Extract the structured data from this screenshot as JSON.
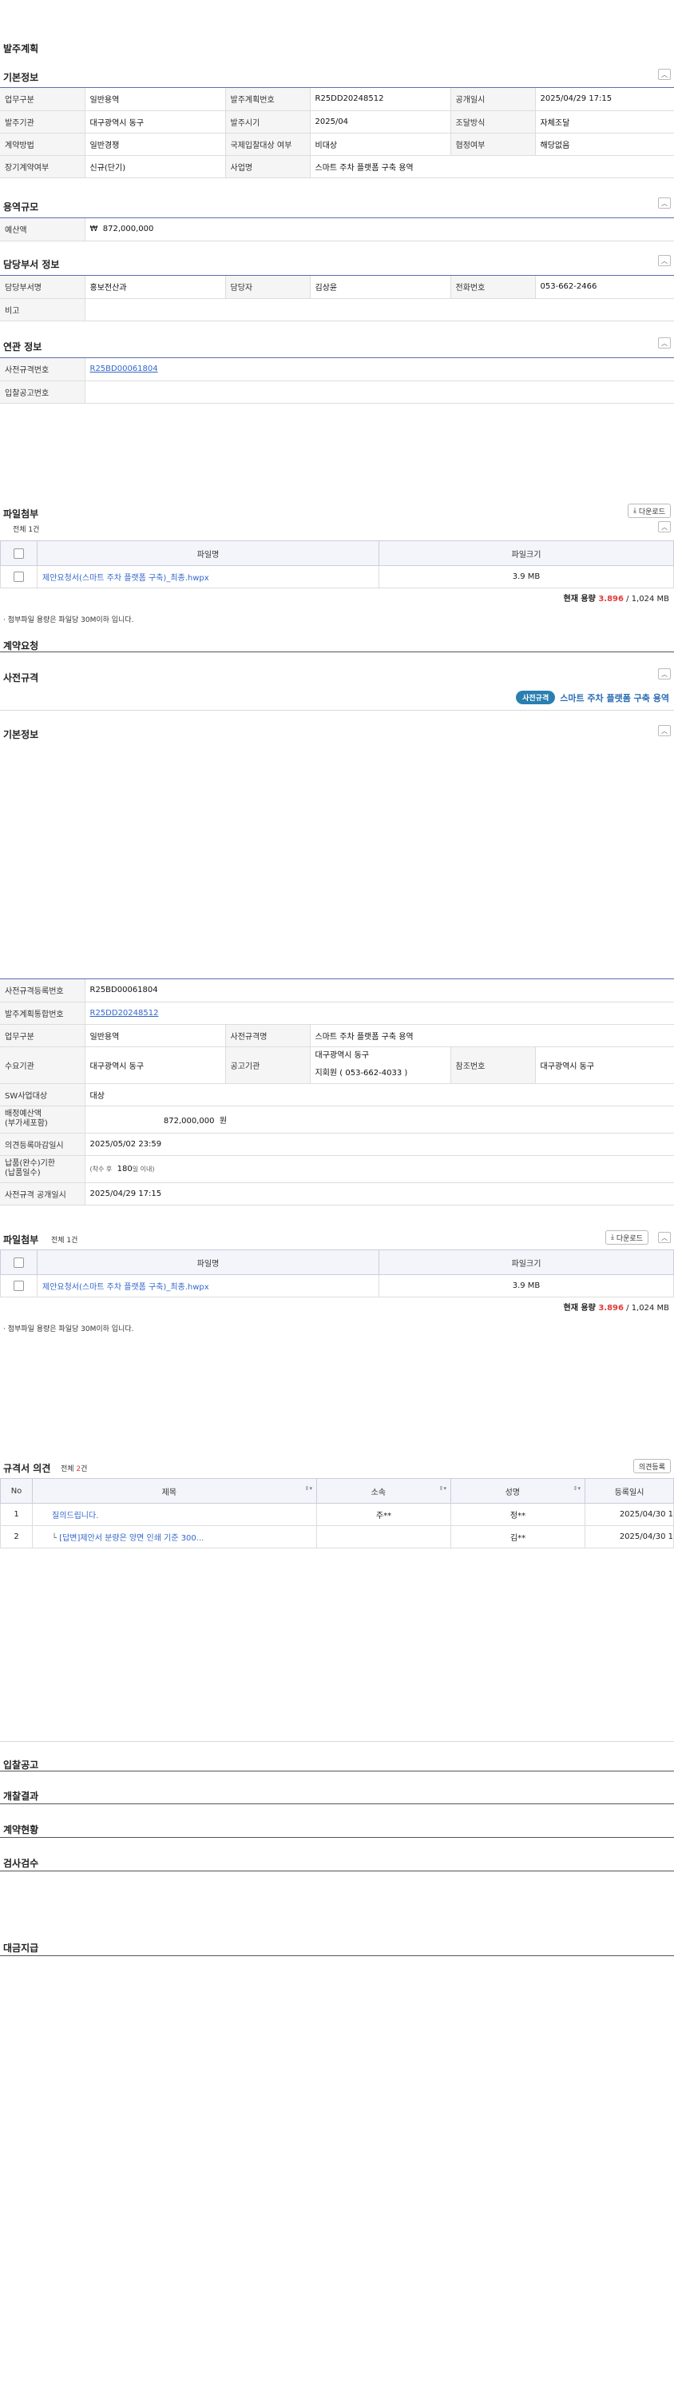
{
  "page_title": "발주계획",
  "basic": {
    "title": "기본정보",
    "rows": [
      [
        {
          "l": "업무구분",
          "v": "일반용역"
        },
        {
          "l": "발주계획번호",
          "v": "R25DD20248512"
        },
        {
          "l": "공개일시",
          "v": "2025/04/29 17:15"
        }
      ],
      [
        {
          "l": "발주기관",
          "v": "대구광역시 동구"
        },
        {
          "l": "발주시기",
          "v": "2025/04"
        },
        {
          "l": "조달방식",
          "v": "자체조달"
        }
      ],
      [
        {
          "l": "계약방법",
          "v": "일반경쟁"
        },
        {
          "l": "국제입찰대상 여부",
          "v": "비대상"
        },
        {
          "l": "협정여부",
          "v": "해당없음"
        }
      ],
      [
        {
          "l": "장기계약여부",
          "v": "신규(단기)"
        },
        {
          "l": "사업명",
          "v": "스마트 주차 플랫폼 구축 용역"
        }
      ]
    ]
  },
  "budget": {
    "title": "용역규모",
    "label": "예산액",
    "currency": "₩",
    "value": "872,000,000"
  },
  "dept": {
    "title": "담당부서 정보",
    "row1": [
      {
        "l": "담당부서명",
        "v": "홍보전산과"
      },
      {
        "l": "담당자",
        "v": "김상윤"
      },
      {
        "l": "전화번호",
        "v": "053-662-2466"
      }
    ],
    "remark_label": "비고",
    "remark": ""
  },
  "related": {
    "title": "연관 정보",
    "rows": [
      {
        "l": "사전규격번호",
        "v": "R25BD00061804"
      },
      {
        "l": "입찰공고번호",
        "v": ""
      }
    ]
  },
  "file1": {
    "title": "파일첨부",
    "count_text": "전체 1건",
    "download": "다운로드",
    "col_name": "파일명",
    "col_size": "파일크기",
    "files": [
      {
        "name": "제안요청서(스마트 주차 플랫폼 구축)_최종.hwpx",
        "size": "3.9 MB"
      }
    ],
    "cap_label": "현재 용량",
    "cap_used": "3.896",
    "cap_total": " / 1,024 MB",
    "note": "첨부파일 용량은 파일당 30M이하 입니다."
  },
  "contract_title": "계약요청",
  "prespec": {
    "title": "사전규격",
    "badge": "사전규격",
    "name": "스마트 주차 플랫폼 구축 용역"
  },
  "prespec_basic_title": "기본정보",
  "prespec_detail": {
    "reg_no_label": "사전규격등록번호",
    "reg_no": "R25BD00061804",
    "plan_no_label": "발주계획통합번호",
    "plan_no": "R25DD20248512",
    "biz_label": "업무구분",
    "biz": "일반용역",
    "spec_name_label": "사전규격명",
    "spec_name": "스마트 주차 플랫폼 구축 용역",
    "demand_label": "수요기관",
    "demand": "대구광역시 동구",
    "notice_org_label": "공고기관",
    "notice_org1": "대구광역시 동구",
    "notice_org2": "지회원 ( 053-662-4033 )",
    "ref_label": "참조번호",
    "ref": "대구광역시 동구",
    "sw_label": "SW사업대상",
    "sw": "대상",
    "alloc_label1": "배정예산액",
    "alloc_label2": "(부가세포함)",
    "alloc": "872,000,000",
    "alloc_unit": "원",
    "deadline_label": "의견등록마감일시",
    "deadline": "2025/05/02 23:59",
    "period_label1": "납품(완수)기한",
    "period_label2": "(납품일수)",
    "period_prefix": "(착수 후",
    "period_days": "180",
    "period_suffix": "일 이내)",
    "open_label": "사전규격 공개일시",
    "open": "2025/04/29 17:15"
  },
  "file2": {
    "title": "파일첨부",
    "count_text": "전체 1건",
    "download": "다운로드",
    "col_name": "파일명",
    "col_size": "파일크기",
    "files": [
      {
        "name": "제안요청서(스마트 주차 플랫폼 구축)_최종.hwpx",
        "size": "3.9 MB"
      }
    ],
    "cap_label": "현재 용량",
    "cap_used": "3.896",
    "cap_total": " / 1,024 MB",
    "note": "첨부파일 용량은 파일당 30M이하 입니다."
  },
  "opinions": {
    "title": "규격서 의견",
    "count_prefix": "전체 ",
    "count_num": "2",
    "count_suffix": "건",
    "btn": "의견등록",
    "cols": [
      "No",
      "제목",
      "소속",
      "성명",
      "등록일시"
    ],
    "rows": [
      {
        "no": "1",
        "title": "질의드립니다.",
        "org": "주**",
        "name": "정**",
        "date": "2025/04/30 1"
      },
      {
        "no": "2",
        "title": "[답변]제안서 분량은 양면 인쇄 기준 300...",
        "org": "",
        "name": "김**",
        "date": "2025/04/30 1"
      }
    ]
  },
  "bottom_sections": [
    "입찰공고",
    "개찰결과",
    "계약현황",
    "검사검수",
    "대금지급"
  ]
}
